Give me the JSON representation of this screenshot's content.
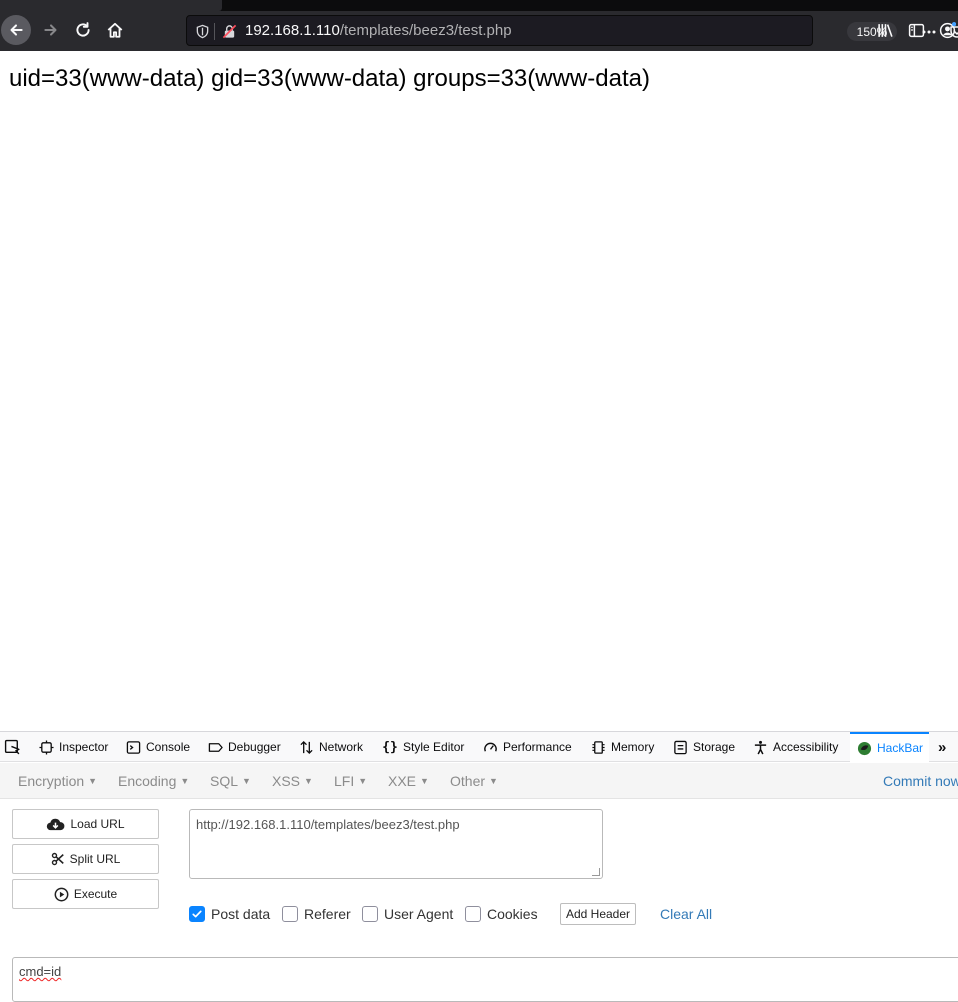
{
  "browser": {
    "url_host": "192.168.1.110",
    "url_path": "/templates/beez3/test.php",
    "zoom": "150%",
    "icons": [
      "back-arrow-icon",
      "forward-arrow-icon",
      "reload-icon",
      "home-icon",
      "shield-icon",
      "insecure-lock-icon",
      "more-icon",
      "pocket-icon",
      "star-icon",
      "library-icon",
      "sidebar-icon",
      "account-icon"
    ]
  },
  "page": {
    "output": "uid=33(www-data) gid=33(www-data) groups=33(www-data)"
  },
  "devtools": {
    "tabs": [
      {
        "label": "Inspector",
        "icon": "inspector-icon"
      },
      {
        "label": "Console",
        "icon": "console-icon"
      },
      {
        "label": "Debugger",
        "icon": "debugger-icon"
      },
      {
        "label": "Network",
        "icon": "network-icon"
      },
      {
        "label": "Style Editor",
        "icon": "style-editor-icon"
      },
      {
        "label": "Performance",
        "icon": "performance-icon"
      },
      {
        "label": "Memory",
        "icon": "memory-icon"
      },
      {
        "label": "Storage",
        "icon": "storage-icon"
      },
      {
        "label": "Accessibility",
        "icon": "accessibility-icon"
      },
      {
        "label": "HackBar",
        "icon": "hackbar-icon"
      }
    ],
    "active_tab": "HackBar"
  },
  "hackbar": {
    "menu": [
      "Encryption",
      "Encoding",
      "SQL",
      "XSS",
      "LFI",
      "XXE",
      "Other"
    ],
    "commit_label": "Commit now",
    "buttons": {
      "load_url": "Load URL",
      "split_url": "Split URL",
      "execute": "Execute"
    },
    "url_value": "http://192.168.1.110/templates/beez3/test.php",
    "options": {
      "post_data": {
        "label": "Post data",
        "checked": true
      },
      "referer": {
        "label": "Referer",
        "checked": false
      },
      "user_agent": {
        "label": "User Agent",
        "checked": false
      },
      "cookies": {
        "label": "Cookies",
        "checked": false
      }
    },
    "add_header_label": "Add Header",
    "clear_all_label": "Clear All",
    "post_body": "cmd=id"
  },
  "colors": {
    "chrome_dark": "#2a2a2e",
    "accent_blue": "#0a84ff",
    "link_blue": "#337ab7"
  }
}
